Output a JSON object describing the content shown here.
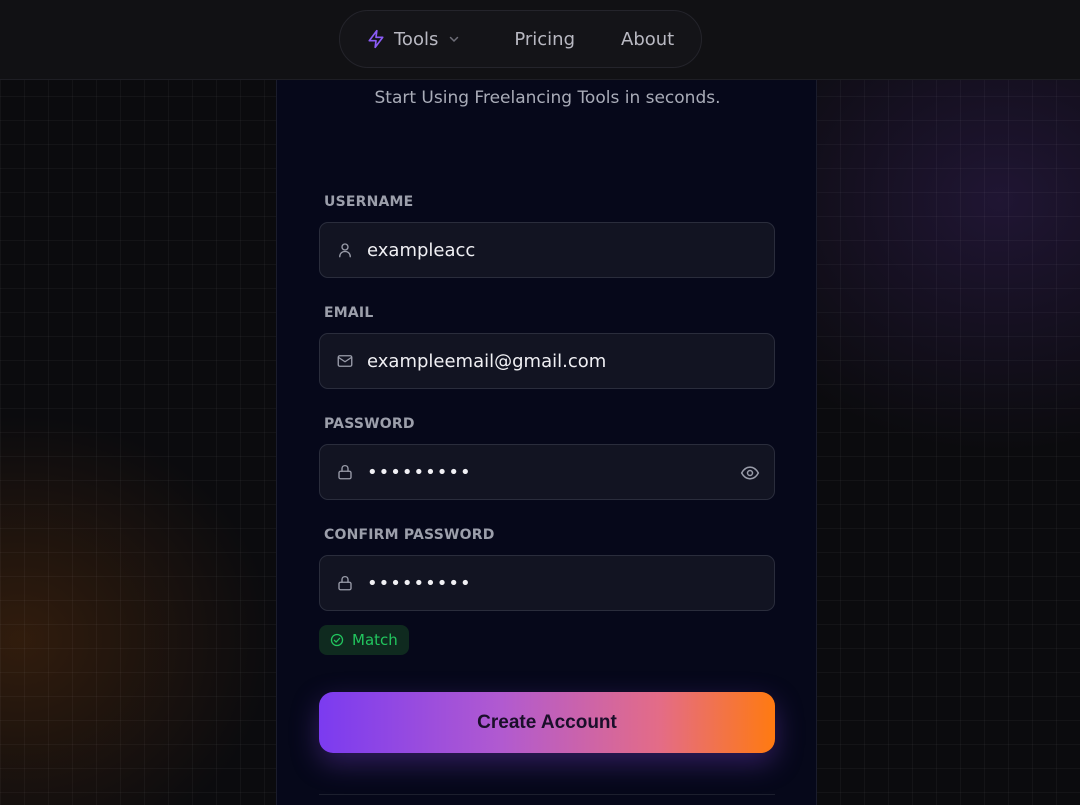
{
  "nav": {
    "tools_label": "Tools",
    "pricing_label": "Pricing",
    "about_label": "About"
  },
  "form": {
    "subtitle": "Start Using Freelancing Tools in seconds.",
    "username": {
      "label": "USERNAME",
      "value": "exampleacc"
    },
    "email": {
      "label": "EMAIL",
      "value": "exampleemail@gmail.com"
    },
    "password": {
      "label": "PASSWORD",
      "value": "•••••••••"
    },
    "confirm_password": {
      "label": "CONFIRM PASSWORD",
      "value": "•••••••••"
    },
    "match_badge": "Match",
    "submit_label": "Create Account"
  },
  "colors": {
    "accent_purple": "#7b3bf0",
    "accent_orange": "#ff7a10",
    "success_green": "#22c55e",
    "card_background": "#06081a"
  },
  "icons": {
    "tools": "bolt-icon",
    "username": "user-icon",
    "email": "mail-icon",
    "password": "lock-icon",
    "show_password": "eye-icon",
    "match": "check-circle-icon"
  }
}
